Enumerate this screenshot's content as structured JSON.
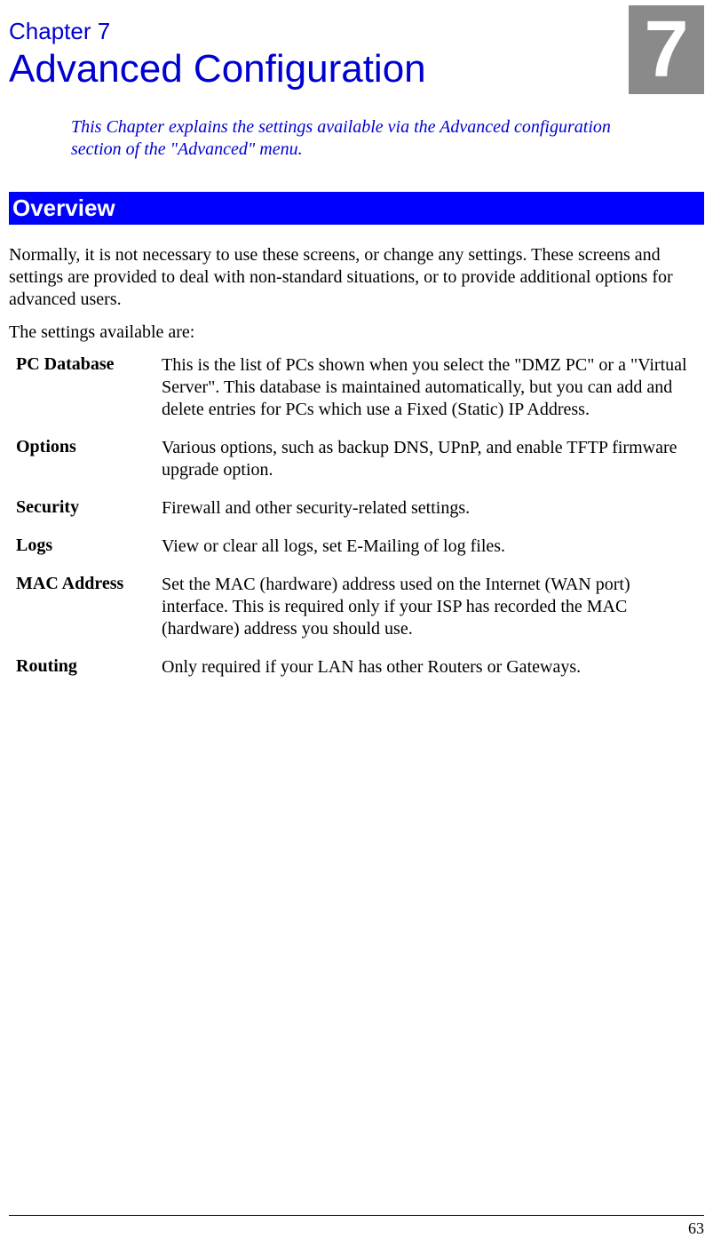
{
  "chapter": {
    "label": "Chapter 7",
    "title": "Advanced Configuration",
    "number": "7",
    "description": "This Chapter explains the settings available via the Advanced configuration section of the \"Advanced\" menu."
  },
  "section": {
    "header": "Overview"
  },
  "body": {
    "para1": "Normally, it is not necessary to use these screens, or change any settings. These screens and settings are provided to deal with non-standard situations, or to provide additional options for advanced users.",
    "para2": "The settings available are:"
  },
  "settings": [
    {
      "term": "PC Database",
      "def": "This is the list of PCs shown when you select the \"DMZ PC\" or a \"Virtual Server\". This database is maintained automatically, but you can add and delete entries for PCs which use a Fixed (Static) IP Address."
    },
    {
      "term": "Options",
      "def": "Various options, such as backup DNS, UPnP, and enable TFTP firmware upgrade option."
    },
    {
      "term": "Security",
      "def": "Firewall and other security-related settings."
    },
    {
      "term": "Logs",
      "def": "View or clear all logs, set E-Mailing of log files."
    },
    {
      "term": "MAC Address",
      "def": "Set the MAC (hardware) address used on the Internet (WAN port) interface. This is required only if your ISP has recorded the MAC (hardware) address you should use."
    },
    {
      "term": "Routing",
      "def": "Only required if your LAN has other Routers or Gateways."
    }
  ],
  "pageNumber": "63"
}
